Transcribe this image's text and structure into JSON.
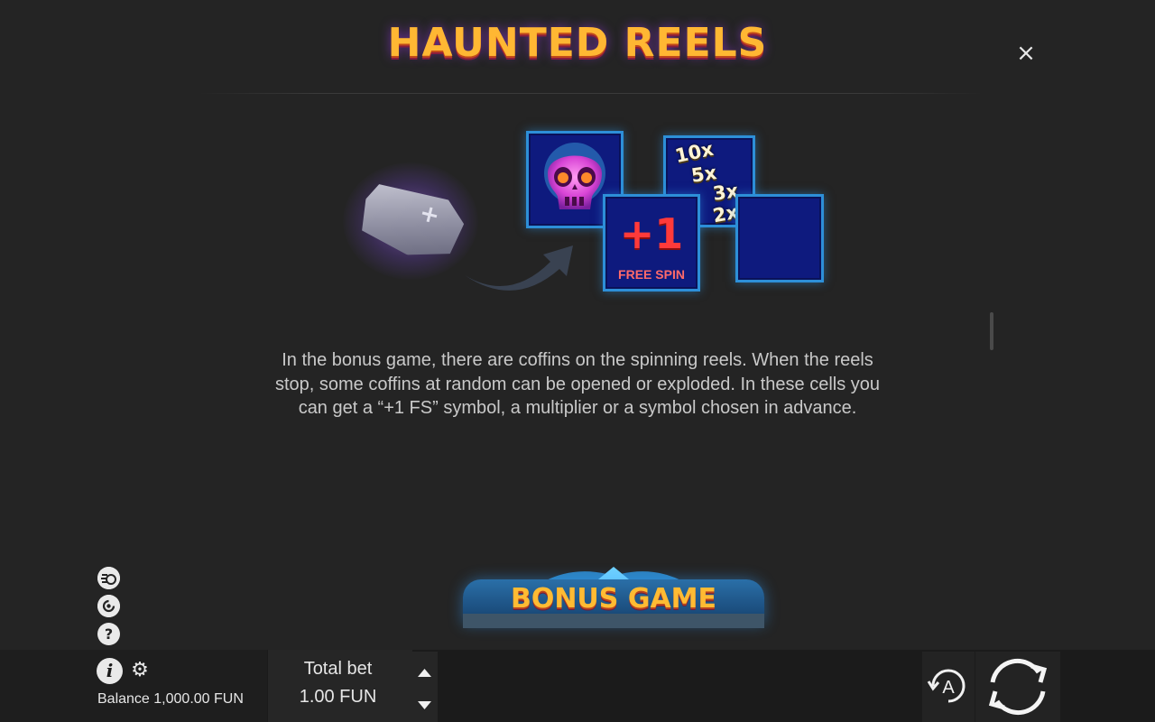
{
  "header": {
    "logo_text": "HAUNTED REELS",
    "close_label": "×"
  },
  "illustration": {
    "free_spin_symbol": "+1",
    "free_spin_label": "FREE SPIN",
    "multipliers": [
      "10x",
      "5x",
      "3x",
      "2x"
    ],
    "icons": [
      "coffin-icon",
      "arrow-icon",
      "skull-icon"
    ]
  },
  "description": {
    "text": "In the bonus game, there are coffins on the spinning reels. When the reels stop, some coffins at random can be opened or exploded. In these cells you can get a “+1 FS” symbol, a multiplier or a symbol chosen in advance."
  },
  "next_section": {
    "banner_text": "BONUS GAME"
  },
  "side_icons": {
    "turbo": "turbo-icon",
    "history": "history-icon",
    "help_label": "?"
  },
  "bottom_bar": {
    "info_label": "i",
    "balance_label": "Balance",
    "balance_value": "1,000.00 FUN",
    "bet_label": "Total bet",
    "bet_value": "1.00 FUN",
    "auto_label": "A"
  },
  "colors": {
    "background": "#242424",
    "cell_fill": "#0e1a7e",
    "cell_border": "#2d8fd8",
    "logo_gold": "#ffb733",
    "free_spin_red": "#ff3a3a"
  }
}
